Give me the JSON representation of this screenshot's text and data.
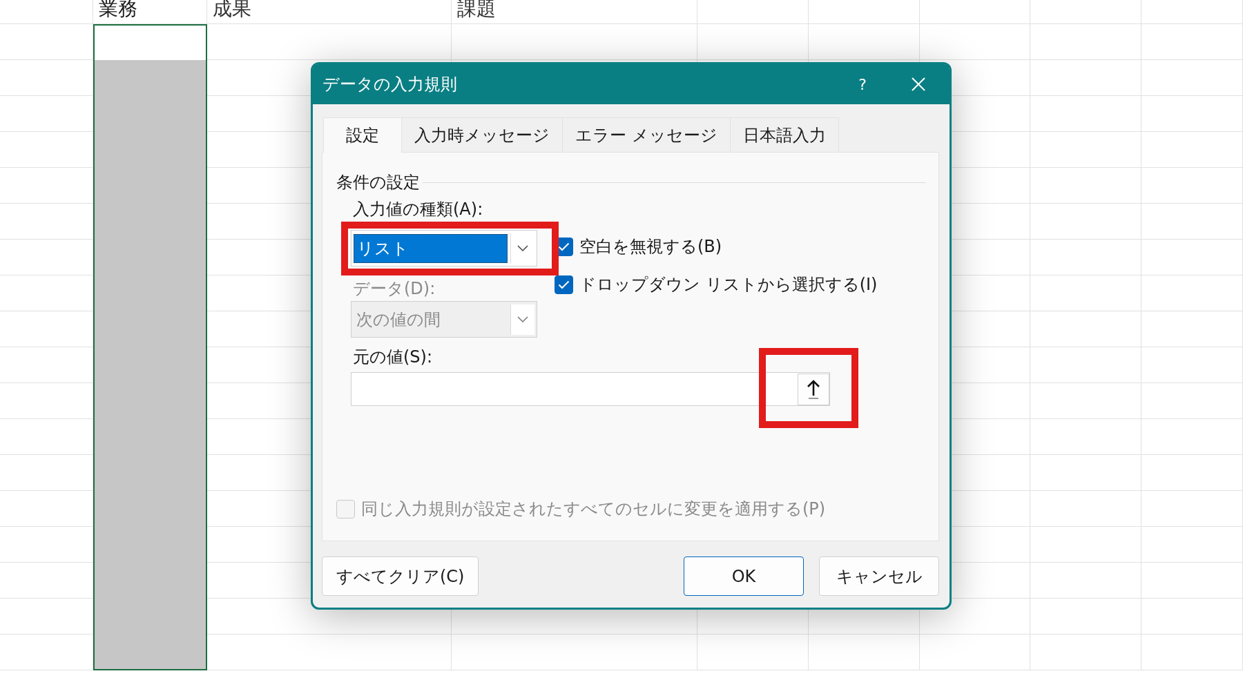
{
  "sheet": {
    "columns": [
      {
        "header": "業務",
        "selected": true
      },
      {
        "header": "成果",
        "selected": false
      },
      {
        "header": "課題",
        "selected": false
      }
    ]
  },
  "dialog": {
    "title": "データの入力規則",
    "help": "?",
    "tabs": [
      {
        "label": "設定",
        "selected": true
      },
      {
        "label": "入力時メッセージ",
        "selected": false
      },
      {
        "label": "エラー メッセージ",
        "selected": false
      },
      {
        "label": "日本語入力",
        "selected": false
      }
    ],
    "settings": {
      "group_label": "条件の設定",
      "allow": {
        "label": "入力値の種類(A):",
        "value": "リスト",
        "value_selected": true,
        "disabled": false,
        "highlighted": true
      },
      "options": [
        {
          "label": "空白を無視する(B)",
          "checked": true,
          "disabled": false
        },
        {
          "label": "ドロップダウン リストから選択する(I)",
          "checked": true,
          "disabled": false
        }
      ],
      "data": {
        "label": "データ(D):",
        "value": "次の値の間",
        "disabled": true
      },
      "source": {
        "label": "元の値(S):",
        "range_button_highlighted": true
      },
      "apply_all": {
        "label": "同じ入力規則が設定されたすべてのセルに変更を適用する(P)",
        "checked": false,
        "disabled": true
      }
    },
    "buttons": [
      {
        "label": "すべてクリア(C)",
        "default": false
      },
      {
        "label": "OK",
        "default": true
      },
      {
        "label": "キャンセル",
        "default": false
      }
    ]
  }
}
